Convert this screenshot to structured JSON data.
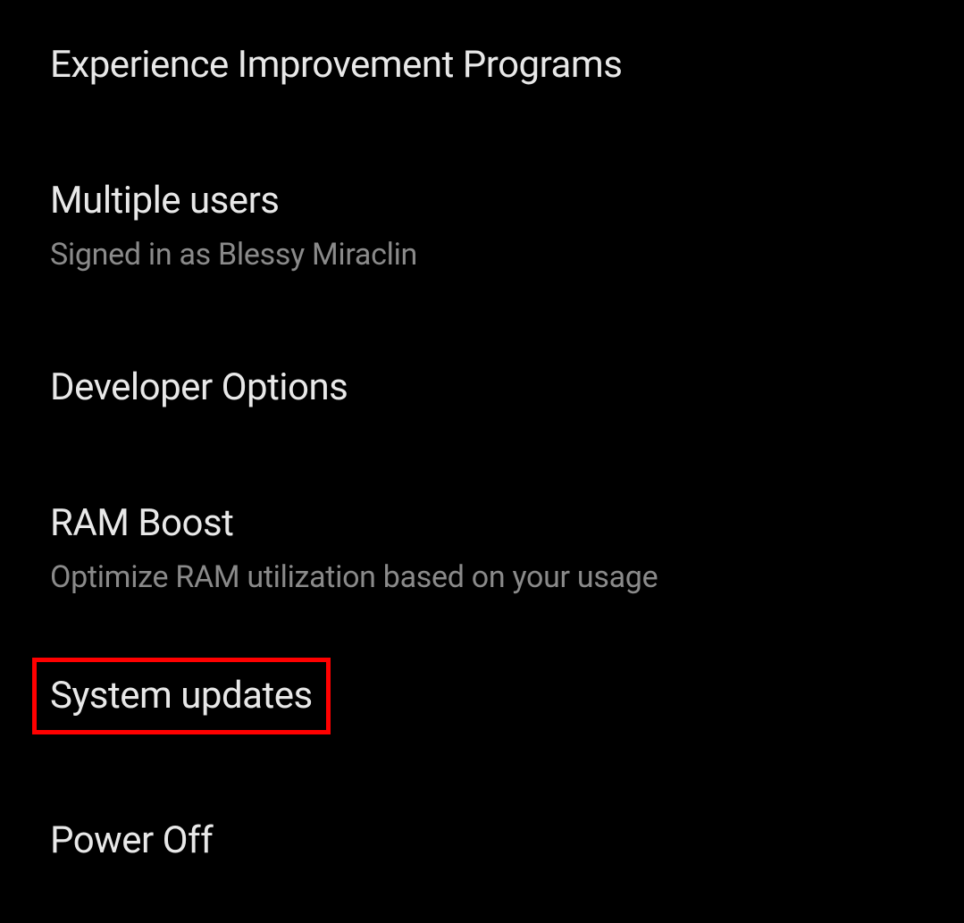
{
  "settings": {
    "items": [
      {
        "title": "Experience Improvement Programs",
        "subtitle": null
      },
      {
        "title": "Multiple users",
        "subtitle": "Signed in as Blessy Miraclin"
      },
      {
        "title": "Developer Options",
        "subtitle": null
      },
      {
        "title": "RAM Boost",
        "subtitle": "Optimize RAM utilization based on your usage"
      },
      {
        "title": "System updates",
        "subtitle": null
      },
      {
        "title": "Power Off",
        "subtitle": null
      }
    ]
  }
}
